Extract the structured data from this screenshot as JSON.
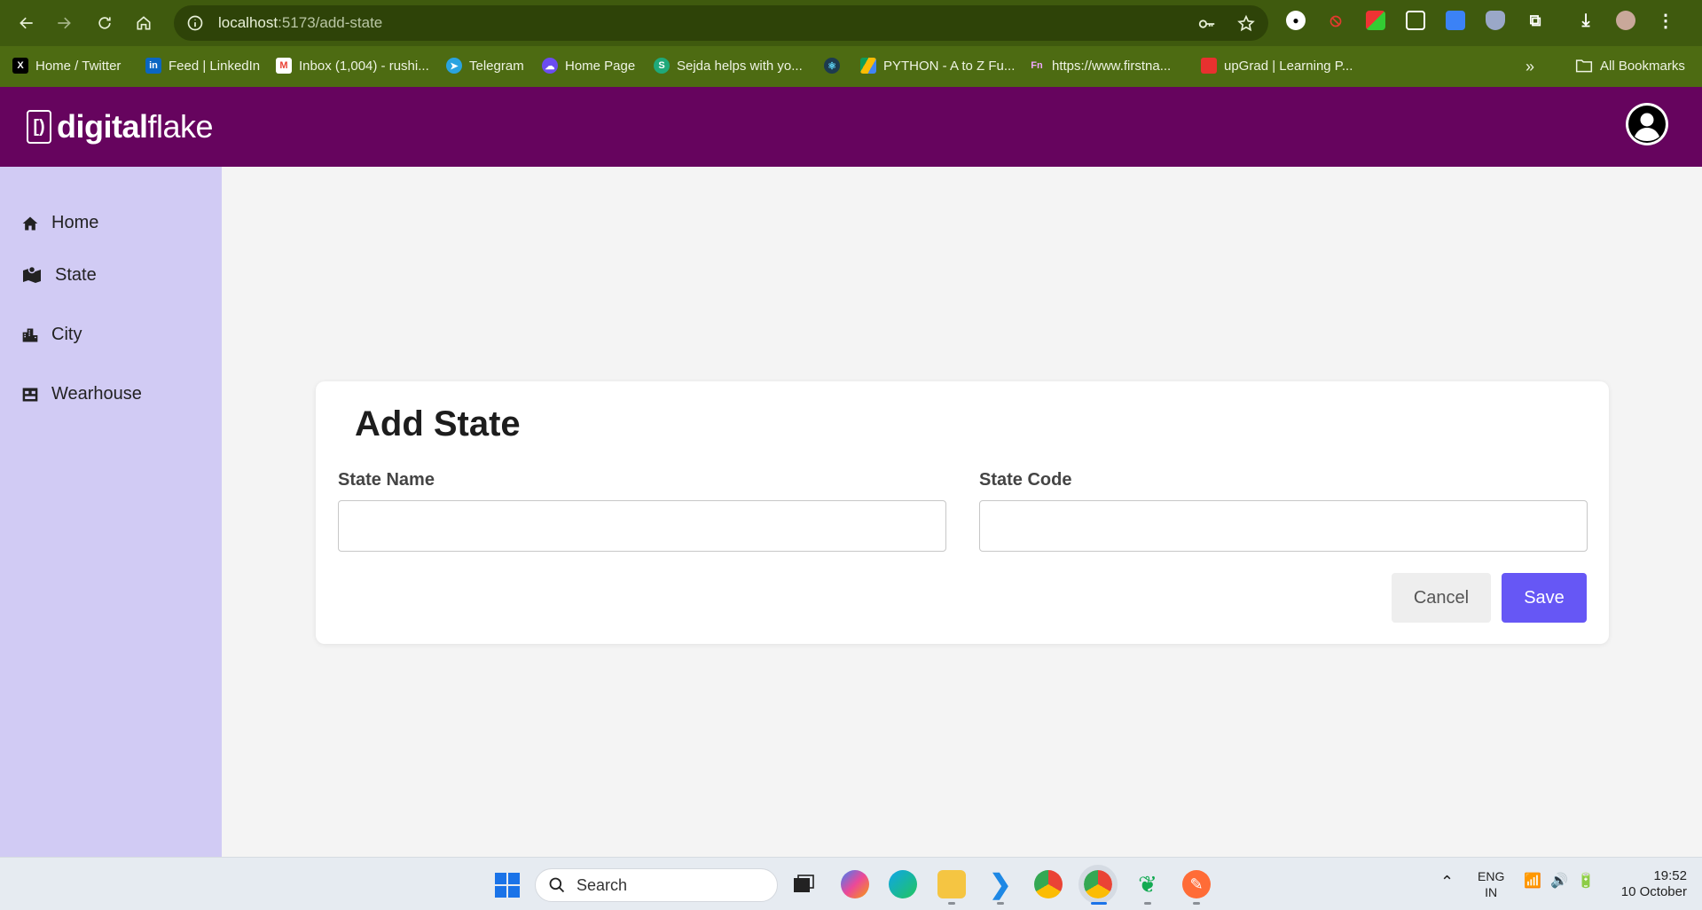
{
  "browser": {
    "url_host": "localhost",
    "url_path": ":5173/add-state",
    "bookmarks": [
      {
        "label": "Home / Twitter",
        "icon": "x-icon",
        "color": "#000000"
      },
      {
        "label": "Feed | LinkedIn",
        "icon": "linkedin-icon",
        "color": "#0a66c2"
      },
      {
        "label": "Inbox (1,004) - rushi...",
        "icon": "gmail-icon",
        "color": "#ea4335"
      },
      {
        "label": "Telegram",
        "icon": "telegram-icon",
        "color": "#2aa3e0"
      },
      {
        "label": "Home Page",
        "icon": "cloud-icon",
        "color": "#6b4cf0"
      },
      {
        "label": "Sejda helps with yo...",
        "icon": "sejda-icon",
        "color": "#1fa97a"
      },
      {
        "label": "",
        "icon": "react-icon",
        "color": "#1d3b4f"
      },
      {
        "label": "PYTHON - A to Z Fu...",
        "icon": "drive-icon",
        "color": "#fbbc04"
      },
      {
        "label": "https://www.firstna...",
        "icon": "fn-icon",
        "color": "#7a4ee0"
      },
      {
        "label": "upGrad | Learning P...",
        "icon": "upgrad-icon",
        "color": "#e8312f"
      }
    ],
    "all_bookmarks": "All Bookmarks",
    "more_bookmarks": "»"
  },
  "app": {
    "logo_bracket": "[)",
    "logo_bold": "digital",
    "logo_light": "flake",
    "brand_color": "#66045e"
  },
  "sidebar": {
    "items": [
      {
        "label": "Home",
        "icon": "house-icon"
      },
      {
        "label": "State",
        "icon": "map-icon"
      },
      {
        "label": "City",
        "icon": "city-icon"
      },
      {
        "label": "Wearhouse",
        "icon": "warehouse-icon"
      }
    ]
  },
  "form": {
    "title": "Add State",
    "state_name_label": "State Name",
    "state_name_value": "",
    "state_code_label": "State Code",
    "state_code_value": "",
    "cancel_label": "Cancel",
    "save_label": "Save",
    "save_color": "#6657f5"
  },
  "taskbar": {
    "search_placeholder": "Search",
    "lang_top": "ENG",
    "lang_bottom": "IN",
    "time": "19:52",
    "date": "10 October"
  }
}
